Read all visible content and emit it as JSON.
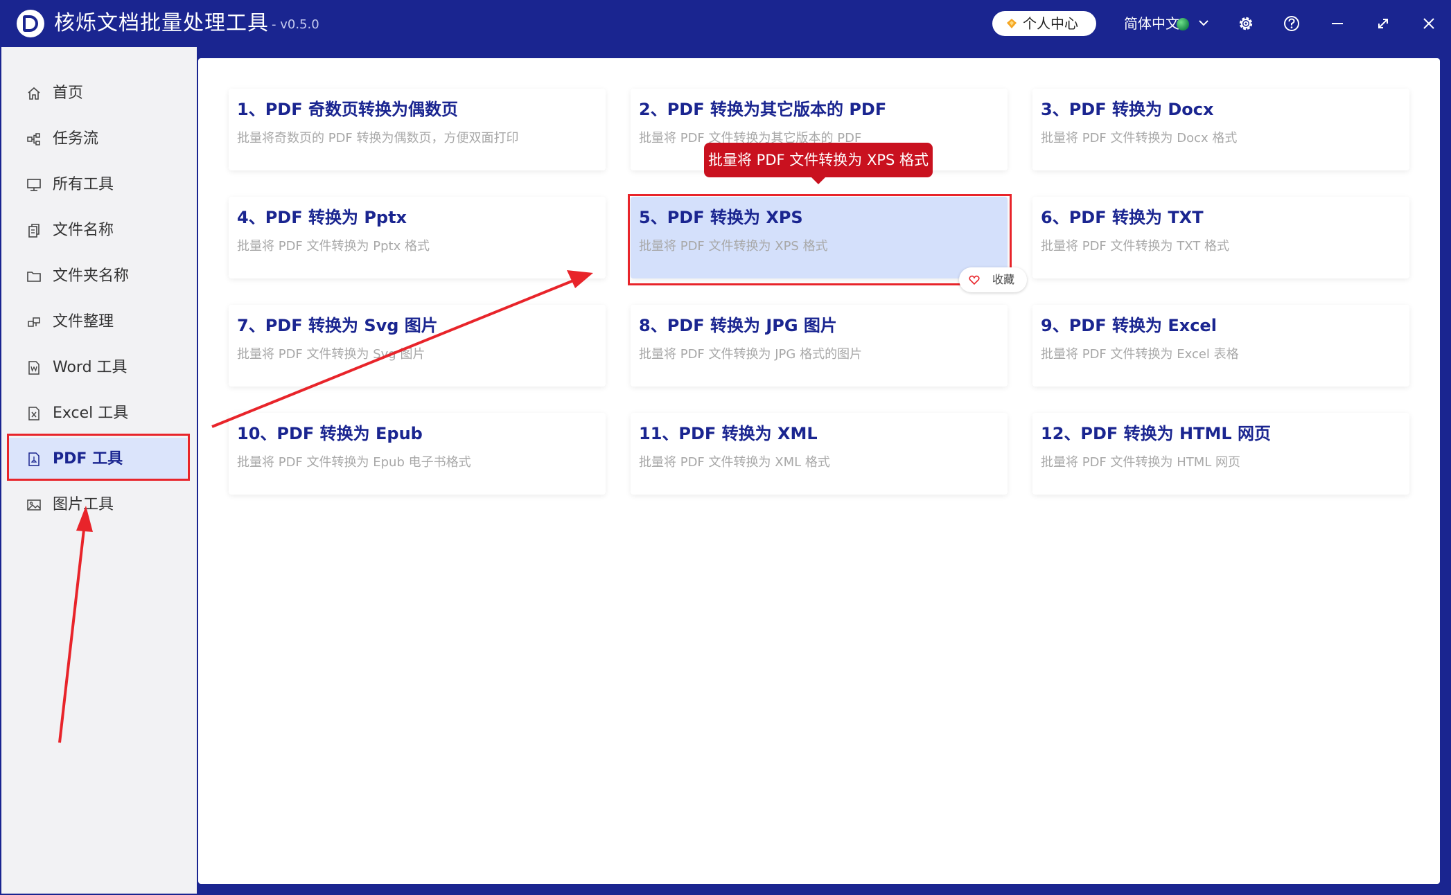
{
  "app": {
    "title": "核烁文档批量处理工具",
    "version": "- v0.5.0",
    "user_center": "个人中心",
    "language": "简体中文"
  },
  "sidebar": {
    "items": [
      {
        "label": "首页",
        "icon": "home-icon"
      },
      {
        "label": "任务流",
        "icon": "workflow-icon"
      },
      {
        "label": "所有工具",
        "icon": "monitor-icon"
      },
      {
        "label": "文件名称",
        "icon": "file-copy-icon"
      },
      {
        "label": "文件夹名称",
        "icon": "folder-icon"
      },
      {
        "label": "文件整理",
        "icon": "organize-icon"
      },
      {
        "label": "Word 工具",
        "icon": "word-file-icon"
      },
      {
        "label": "Excel 工具",
        "icon": "excel-file-icon"
      },
      {
        "label": "PDF 工具",
        "icon": "pdf-file-icon"
      },
      {
        "label": "图片工具",
        "icon": "image-icon"
      }
    ],
    "active_index": 8
  },
  "cards": [
    {
      "title": "1、PDF 奇数页转换为偶数页",
      "desc": "批量将奇数页的 PDF 转换为偶数页，方便双面打印"
    },
    {
      "title": "2、PDF 转换为其它版本的 PDF",
      "desc": "批量将 PDF 文件转换为其它版本的 PDF"
    },
    {
      "title": "3、PDF 转换为 Docx",
      "desc": "批量将 PDF 文件转换为 Docx 格式"
    },
    {
      "title": "4、PDF 转换为 Pptx",
      "desc": "批量将 PDF 文件转换为 Pptx 格式"
    },
    {
      "title": "5、PDF 转换为 XPS",
      "desc": "批量将 PDF 文件转换为 XPS 格式"
    },
    {
      "title": "6、PDF 转换为 TXT",
      "desc": "批量将 PDF 文件转换为 TXT 格式"
    },
    {
      "title": "7、PDF 转换为 Svg 图片",
      "desc": "批量将 PDF 文件转换为 Svg 图片"
    },
    {
      "title": "8、PDF 转换为 JPG 图片",
      "desc": "批量将 PDF 文件转换为 JPG 格式的图片"
    },
    {
      "title": "9、PDF 转换为 Excel",
      "desc": "批量将 PDF 文件转换为 Excel 表格"
    },
    {
      "title": "10、PDF 转换为 Epub",
      "desc": "批量将 PDF 文件转换为 Epub 电子书格式"
    },
    {
      "title": "11、PDF 转换为 XML",
      "desc": "批量将 PDF 文件转换为 XML 格式"
    },
    {
      "title": "12、PDF 转换为 HTML 网页",
      "desc": "批量将 PDF 文件转换为 HTML 网页"
    }
  ],
  "highlighted_card": 4,
  "tooltip": "批量将 PDF 文件转换为 XPS 格式",
  "favorite_label": "收藏",
  "colors": {
    "brand": "#1a2590",
    "highlight": "#d4e0fb",
    "annotation_red": "#e8242a",
    "tooltip": "#c9111f"
  }
}
